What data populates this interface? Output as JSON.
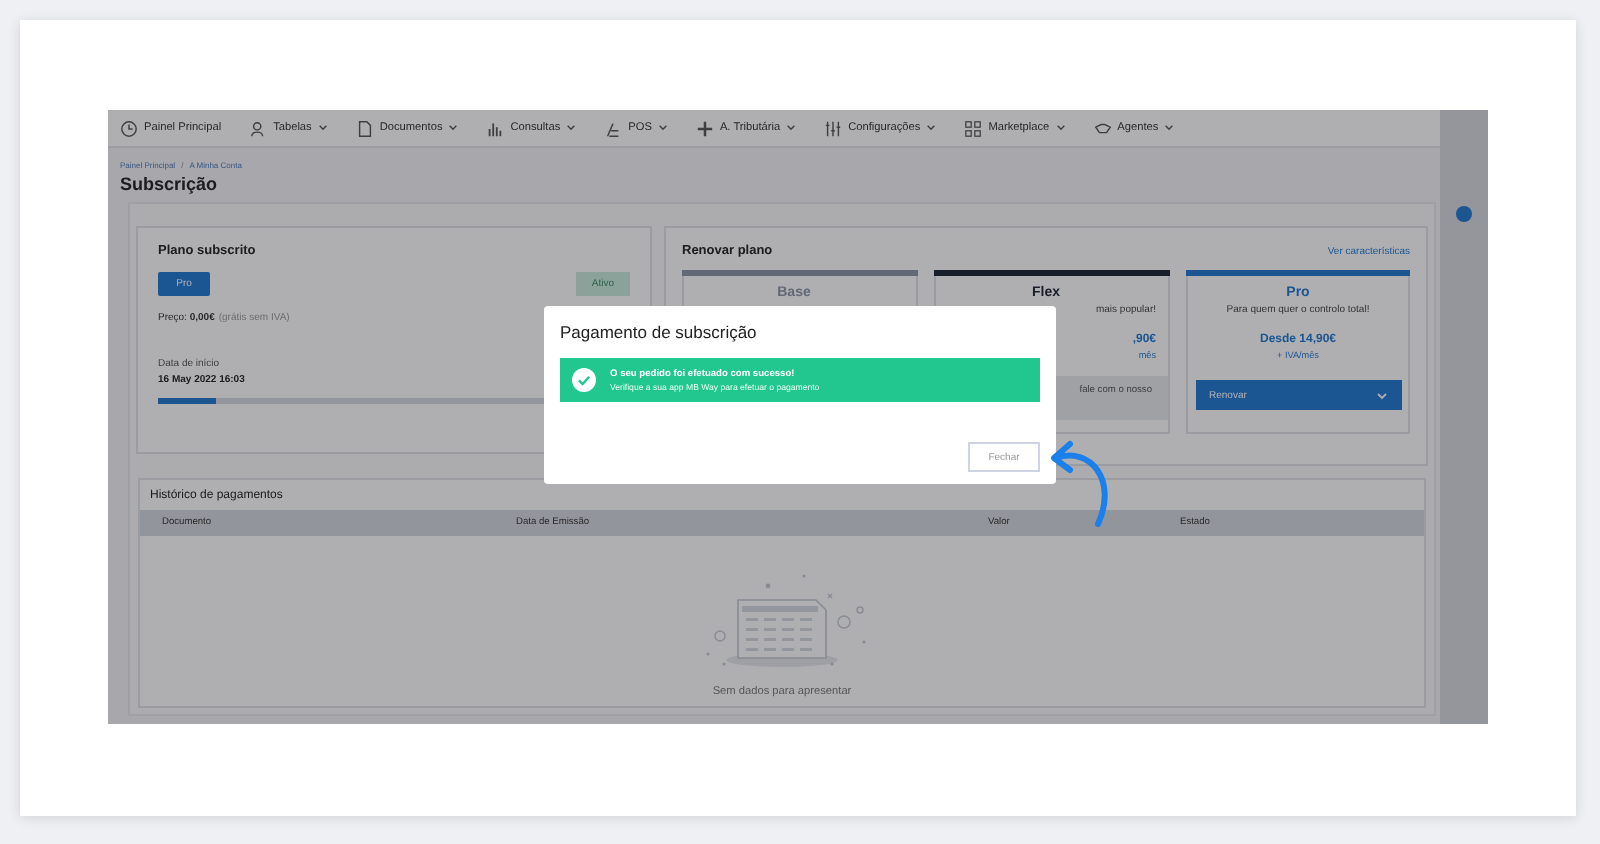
{
  "nav": {
    "items": [
      {
        "label": "Painel Principal",
        "dropdown": false
      },
      {
        "label": "Tabelas",
        "dropdown": true
      },
      {
        "label": "Documentos",
        "dropdown": true
      },
      {
        "label": "Consultas",
        "dropdown": true
      },
      {
        "label": "POS",
        "dropdown": true
      },
      {
        "label": "A. Tributária",
        "dropdown": true
      },
      {
        "label": "Configurações",
        "dropdown": true
      },
      {
        "label": "Marketplace",
        "dropdown": true
      },
      {
        "label": "Agentes",
        "dropdown": true
      }
    ]
  },
  "breadcrumb": {
    "items": [
      "Painel Principal",
      "A Minha Conta"
    ],
    "separator": "/"
  },
  "page_title": "Subscrição",
  "current_plan": {
    "title": "Plano subscrito",
    "plan": "Pro",
    "status": "Ativo",
    "price": "Preço: **0,00€**",
    "price_note": "(grátis sem IVA)",
    "start_label": "Data de início",
    "start_date": "16 May 2022 16:03",
    "level": 0.12
  },
  "renew": {
    "title": "Renovar plano",
    "link": "Ver características",
    "tiers": [
      {
        "name": "Base",
        "color": "#626876",
        "kind": "covered"
      },
      {
        "name": "Flex",
        "color": "#191f2a",
        "kind": "covered",
        "subtitle": "mais popular!",
        "price": ",90€",
        "price_note": "mês",
        "contact": "fale com o nosso"
      },
      {
        "name": "Pro",
        "color": "#1b5692",
        "kind": "full",
        "subtitle": "Para quem quer o controlo total!",
        "price": "Desde 14,90€",
        "price_note": "+ IVA/mês",
        "button": "Renovar"
      }
    ]
  },
  "history": {
    "title": "Histórico de pagamentos",
    "columns": [
      "Documento",
      "Data de Emissão",
      "Valor",
      "Estado"
    ],
    "empty": "Sem dados para apresentar"
  },
  "modal": {
    "title": "Pagamento de subscrição",
    "message": "O seu pedido foi efetuado com sucesso!",
    "detail": "Verifique a sua app MB Way para efetuar o pagamento",
    "button": "Fechar"
  }
}
